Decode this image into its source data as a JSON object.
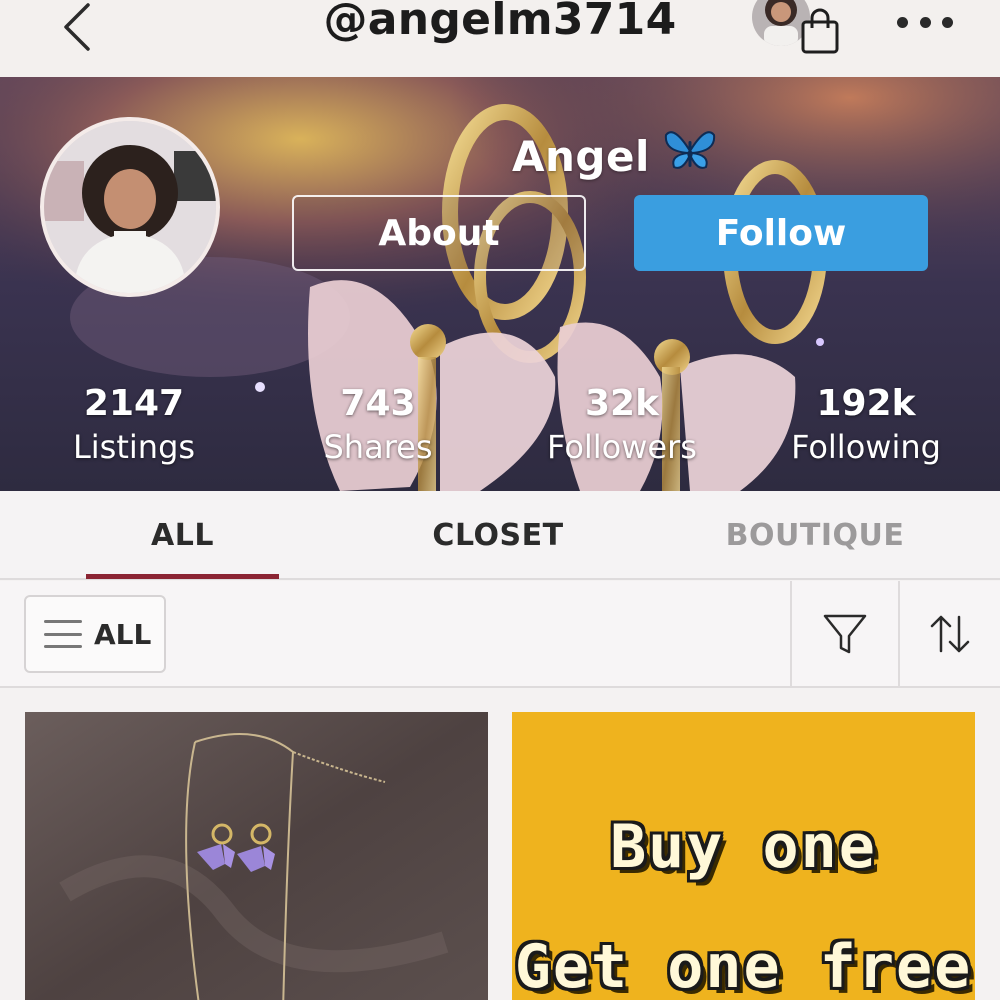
{
  "header": {
    "handle": "@angelm3714",
    "back_icon": "chevron-left-icon",
    "bag_icon": "shopping-bag-icon",
    "more_icon": "more-horizontal-icon"
  },
  "profile": {
    "name": "Angel",
    "name_emoji": "🦋",
    "about_label": "About",
    "follow_label": "Follow",
    "follow_color": "#3a9ee0"
  },
  "stats": [
    {
      "value": "2147",
      "label": "Listings"
    },
    {
      "value": "743",
      "label": "Shares"
    },
    {
      "value": "32k",
      "label": "Followers"
    },
    {
      "value": "192k",
      "label": "Following"
    }
  ],
  "tabs": [
    {
      "label": "ALL",
      "active": true
    },
    {
      "label": "CLOSET",
      "active": false
    },
    {
      "label": "BOUTIQUE",
      "active": false
    }
  ],
  "tab_accent": "#8b2433",
  "filter": {
    "dropdown_label": "ALL",
    "filter_icon": "filter-funnel-icon",
    "sort_icon": "sort-arrows-icon"
  },
  "listings": [
    {
      "image": "necklace-with-purple-butterfly-earrings"
    },
    {
      "image": "promo-banner",
      "line1": "Buy one",
      "line2": "Get one free"
    }
  ]
}
